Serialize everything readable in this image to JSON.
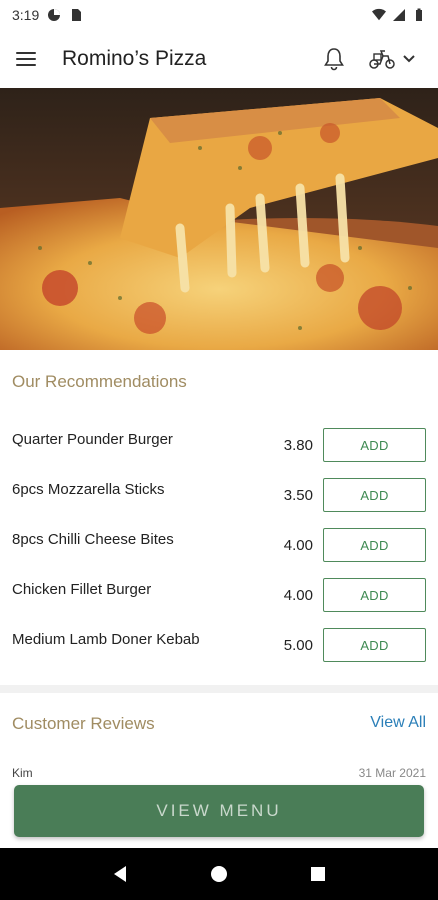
{
  "status_bar": {
    "time": "3:19",
    "icons": [
      "pie-chart-icon",
      "sim-card-icon",
      "wifi-icon",
      "signal-icon",
      "battery-icon"
    ]
  },
  "app_bar": {
    "title": "Romino’s Pizza",
    "icons": [
      "hamburger-menu-icon",
      "bell-icon",
      "scooter-icon",
      "chevron-down-icon"
    ]
  },
  "hero": {
    "image": "cheese-pizza-photo"
  },
  "recommendations": {
    "title": "Our Recommendations",
    "add_label": "ADD",
    "items": [
      {
        "name": "Quarter Pounder Burger",
        "price": "3.80"
      },
      {
        "name": "6pcs Mozzarella Sticks",
        "price": "3.50"
      },
      {
        "name": "8pcs Chilli Cheese Bites",
        "price": "4.00"
      },
      {
        "name": "Chicken Fillet Burger",
        "price": "4.00"
      },
      {
        "name": "Medium Lamb Doner Kebab",
        "price": "5.00"
      }
    ]
  },
  "reviews": {
    "title": "Customer Reviews",
    "view_all": "View All",
    "first_review": {
      "author": "Kim",
      "date": "31 Mar 2021"
    }
  },
  "footer": {
    "view_menu_label": "VIEW MENU"
  },
  "nav_bar": {
    "icons": [
      "back-icon",
      "home-icon",
      "recents-icon"
    ]
  },
  "colors": {
    "accent_green": "#4a7d57",
    "add_green": "#3e8a52",
    "section_title": "#a08c62",
    "link_blue": "#2b7fb8"
  }
}
